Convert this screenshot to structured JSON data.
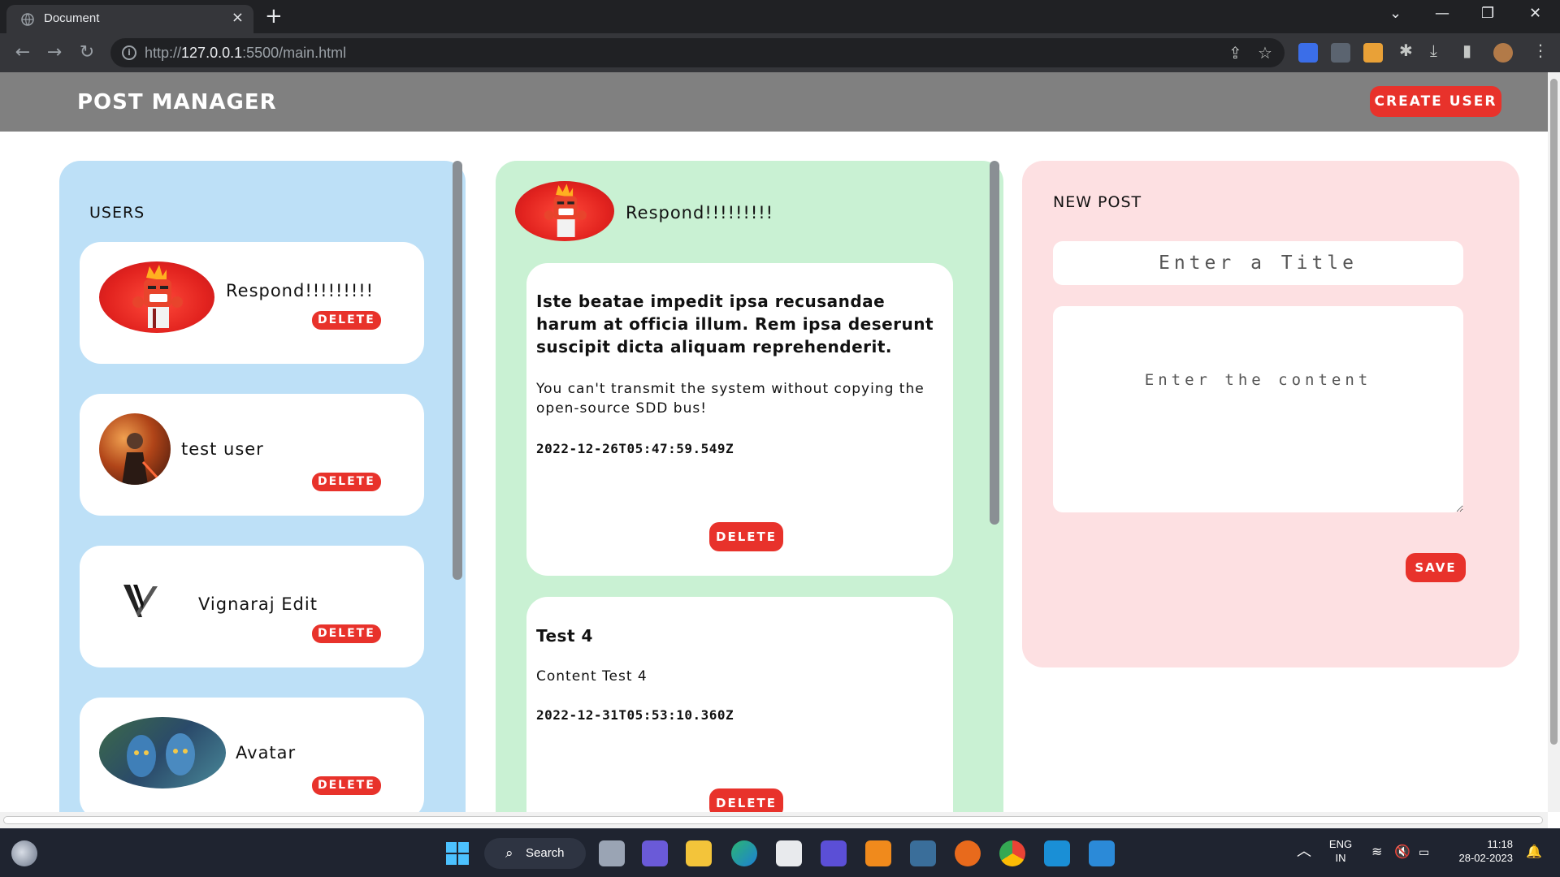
{
  "browser": {
    "tab_title": "Document",
    "tab_close": "×",
    "new_tab": "+",
    "url_prefix": "http://",
    "url_host": "127.0.0.1",
    "url_rest": ":5500/main.html",
    "controls": {
      "chevron": "⌄",
      "minimize": "—",
      "restore": "❐",
      "close": "✕"
    }
  },
  "header": {
    "title": "POST MANAGER",
    "create_user_label": "CREATE USER"
  },
  "users": {
    "heading": "USERS",
    "delete_label": "DELETE",
    "items": [
      {
        "name": "Respond!!!!!!!!!",
        "avatar": "angry-character-avatar"
      },
      {
        "name": "test user",
        "avatar": "sith-character-avatar"
      },
      {
        "name": "Vignaraj Edit",
        "avatar": "v-logo-avatar"
      },
      {
        "name": "Avatar",
        "avatar": "avatar-film-avatar"
      }
    ]
  },
  "posts": {
    "author_name": "Respond!!!!!!!!!",
    "delete_label": "DELETE",
    "items": [
      {
        "title": "Iste beatae impedit ipsa recusandae harum at officia illum. Rem ipsa deserunt suscipit dicta aliquam reprehenderit.",
        "content": "You can't transmit the system without copying the open-source SDD bus!",
        "date": "2022-12-26T05:47:59.549Z"
      },
      {
        "title": "Test 4",
        "content": "Content Test 4",
        "date": "2022-12-31T05:53:10.360Z"
      }
    ]
  },
  "new_post": {
    "heading": "NEW POST",
    "title_placeholder": "Enter a Title",
    "content_placeholder": "Enter the content",
    "save_label": "SAVE"
  },
  "taskbar": {
    "search_label": "Search",
    "lang_line1": "ENG",
    "lang_line2": "IN",
    "time": "11:18",
    "date": "28-02-2023"
  },
  "colors": {
    "accent_red": "#e8322b",
    "users_bg": "#bde0f7",
    "posts_bg": "#c9f1d3",
    "newpost_bg": "#fde0e2",
    "header_bg": "#808080"
  }
}
